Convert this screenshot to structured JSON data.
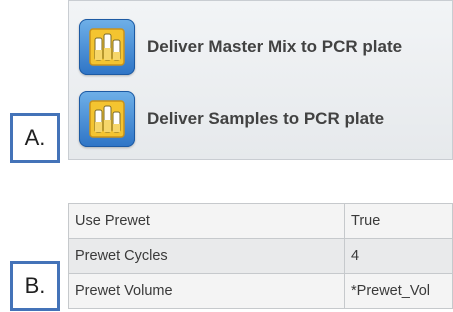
{
  "panel_a": {
    "steps": [
      {
        "label": "Deliver Master Mix to PCR plate",
        "icon": "pipette-reagent-icon"
      },
      {
        "label": "Deliver Samples to PCR plate",
        "icon": "pipette-reagent-icon"
      }
    ],
    "callout": "A."
  },
  "panel_b": {
    "rows": [
      {
        "name": "Use Prewet",
        "value": "True"
      },
      {
        "name": "Prewet Cycles",
        "value": "4"
      },
      {
        "name": "Prewet Volume",
        "value": "*Prewet_Vol"
      }
    ],
    "callout": "B."
  },
  "colors": {
    "callout_border": "#4473b8",
    "icon_blue": "#2e74c6",
    "icon_yellow": "#f4c430"
  }
}
